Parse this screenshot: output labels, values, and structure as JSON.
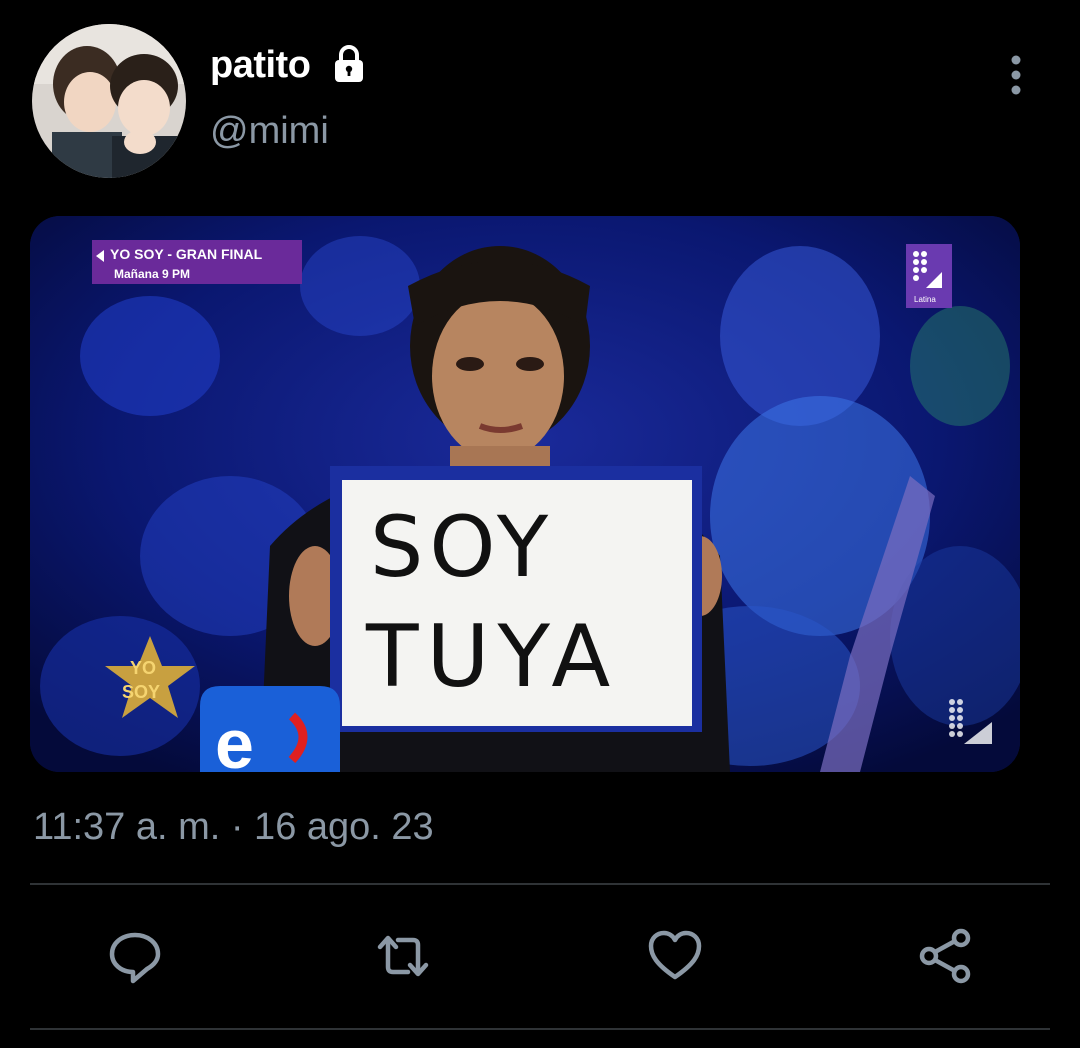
{
  "tweet": {
    "display_name": "patito",
    "handle": "@mimi",
    "timestamp": "11:37 a. m. · 16 ago. 23",
    "protected": true
  },
  "media": {
    "banner_line1": "YO SOY - GRAN FINAL",
    "banner_line2": "Mañana 9 PM",
    "sign_line1": "SOY",
    "sign_line2": "TUYA",
    "show_logo_line1": "YO",
    "show_logo_line2": "SOY",
    "network_logo": "e",
    "channel_logo_sub": "Latina"
  },
  "icons": {
    "lock": "lock-icon",
    "more": "more-vertical-icon",
    "reply": "reply-icon",
    "retweet": "retweet-icon",
    "like": "heart-icon",
    "share": "share-icon"
  },
  "colors": {
    "background": "#000000",
    "primary_text": "#ffffff",
    "secondary_text": "#8b98a5",
    "divider": "#2f3336",
    "icon": "#8b98a5"
  }
}
